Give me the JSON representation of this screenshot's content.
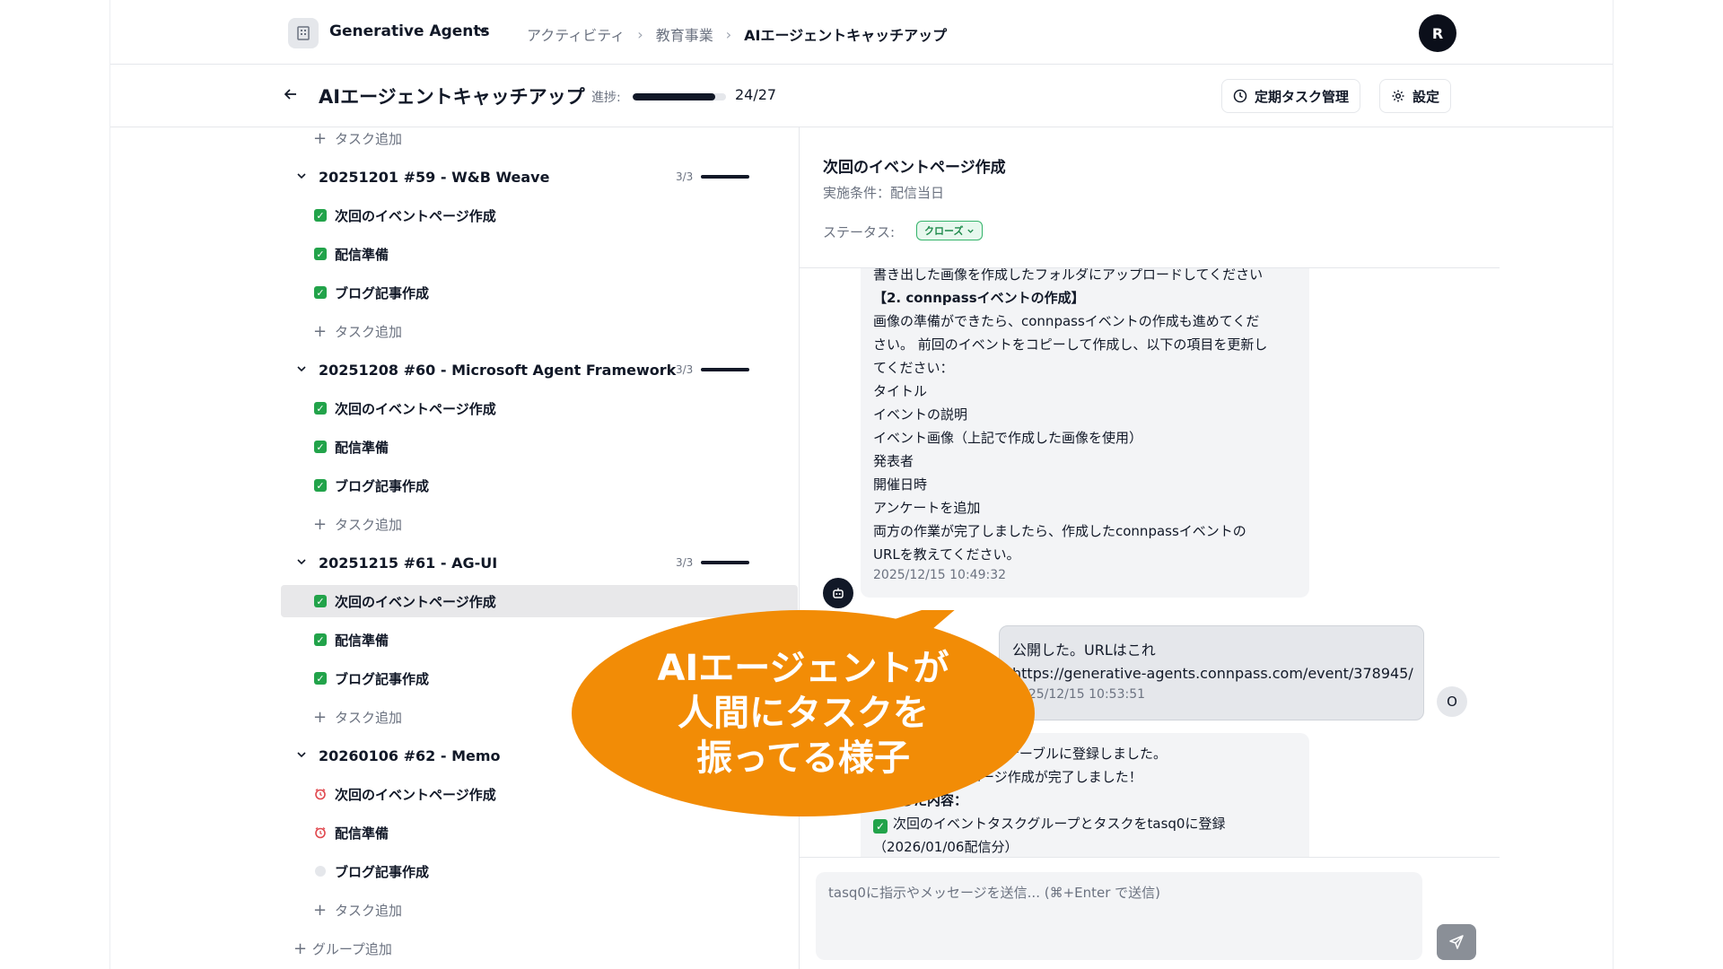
{
  "topnav": {
    "workspace": "Generative Agents",
    "breadcrumbs": [
      "アクティビティ",
      "教育事業",
      "AIエージェントキャッチアップ"
    ],
    "avatar_initial": "R"
  },
  "pagehead": {
    "title": "AIエージェントキャッチアップ",
    "progress_label": "進捗:",
    "progress_fraction": 0.889,
    "progress_count": "24/27",
    "recurring_button": "定期タスク管理",
    "settings_button": "設定"
  },
  "left": {
    "add_task": "タスク追加",
    "add_group": "グループ追加",
    "groups": [
      {
        "title": "20251201 #59 - W&B Weave",
        "count": "3/3",
        "tasks": [
          {
            "title": "次回のイベントページ作成",
            "status": "done"
          },
          {
            "title": "配信準備",
            "status": "done"
          },
          {
            "title": "ブログ記事作成",
            "status": "done"
          }
        ]
      },
      {
        "title": "20251208 #60 - Microsoft Agent Framework",
        "count": "3/3",
        "tasks": [
          {
            "title": "次回のイベントページ作成",
            "status": "done"
          },
          {
            "title": "配信準備",
            "status": "done"
          },
          {
            "title": "ブログ記事作成",
            "status": "done"
          }
        ]
      },
      {
        "title": "20251215 #61 - AG-UI",
        "count": "3/3",
        "tasks": [
          {
            "title": "次回のイベントページ作成",
            "status": "done"
          },
          {
            "title": "配信準備",
            "status": "done"
          },
          {
            "title": "ブログ記事作成",
            "status": "done"
          }
        ]
      },
      {
        "title": "20260106 #62 - Memo",
        "tasks": [
          {
            "title": "次回のイベントページ作成",
            "status": "alarm"
          },
          {
            "title": "配信準備",
            "status": "alarm"
          },
          {
            "title": "ブログ記事作成",
            "status": "todo"
          }
        ]
      }
    ]
  },
  "detail": {
    "title": "次回のイベントページ作成",
    "condition": "実施条件：配信当日",
    "status_label": "ステータス:",
    "status_value": "クローズ"
  },
  "chat": {
    "ai_message_lines": [
      "書き出した画像を作成したフォルダにアップロードしてください",
      "【2. connpassイベントの作成】",
      "画像の準備ができたら、connpassイベントの作成も進めてくだ",
      "さい。 前回のイベントをコピーして作成し、以下の項目を更新し",
      "てください：",
      "タイトル",
      "イベントの説明",
      "イベント画像（上記で作成した画像を使用）",
      "発表者",
      "開催日時",
      "アンケートを追加",
      "両方の作業が完了しましたら、作成したconnpassイベントの",
      "URLを教えてください。"
    ],
    "ai_timestamp": "2025/12/15 10:49:32",
    "user_message_lines": [
      "公開した。URLはこれ",
      "https://generative-agents.connpass.com/event/378945/"
    ],
    "user_timestamp": "2025/12/15 10:53:51",
    "user_avatar": "O",
    "ai2_lines": [
      "nnpass URLをデータテーブルに登録しました。",
      "次回のイベントページ作成が完了しました！",
      "完了した内容：",
      "次回のイベントタスクグループとタスクをtasq0に登録",
      "（2026/01/06配信分）"
    ],
    "input_placeholder": "tasq0に指示やメッセージを送信... (⌘+Enter で送信)"
  },
  "callout": {
    "lines": [
      "AIエージェントが",
      "人間にタスクを",
      "振ってる様子"
    ],
    "color": "#f28c06"
  }
}
